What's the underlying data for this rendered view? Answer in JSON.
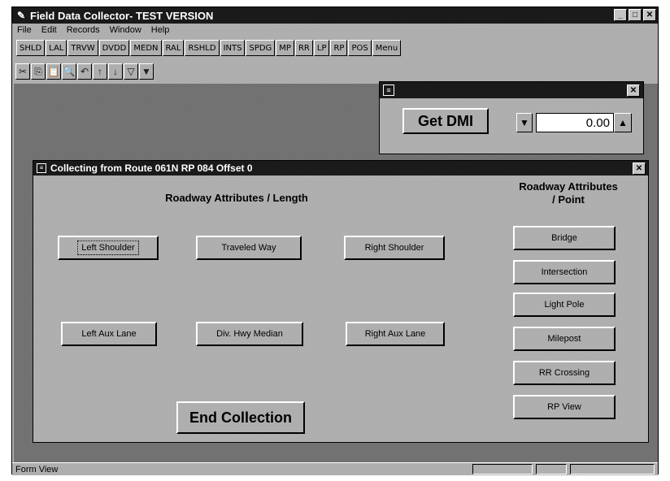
{
  "app": {
    "title": "Field Data Collector- TEST VERSION",
    "window_buttons": {
      "minimize": "_",
      "maximize": "□",
      "close": "✕"
    }
  },
  "menubar": {
    "items": [
      "File",
      "Edit",
      "Records",
      "Window",
      "Help"
    ]
  },
  "field_toolbar": {
    "buttons": [
      "SHLD",
      "LAL",
      "TRVW",
      "DVDD",
      "MEDN",
      "RAL",
      "RSHLD",
      "INTS",
      "SPDG",
      "MP",
      "RR",
      "LP",
      "RP",
      "POS",
      "Menu"
    ]
  },
  "toolbar": {
    "icons": [
      {
        "name": "cut-icon",
        "glyph": "✂"
      },
      {
        "name": "copy-icon",
        "glyph": "⎘"
      },
      {
        "name": "paste-icon",
        "glyph": "📋"
      },
      {
        "name": "find-icon",
        "glyph": "🔍"
      },
      {
        "name": "undo-icon",
        "glyph": "↶"
      },
      {
        "name": "sort-asc-icon",
        "glyph": "↑"
      },
      {
        "name": "sort-desc-icon",
        "glyph": "↓"
      },
      {
        "name": "filter-icon",
        "glyph": "▽"
      },
      {
        "name": "apply-filter-icon",
        "glyph": "▼"
      }
    ]
  },
  "dmi_panel": {
    "title": "",
    "get_dmi_label": "Get DMI",
    "value": "0.00",
    "decrement_glyph": "▼",
    "increment_glyph": "▲"
  },
  "collect_window": {
    "title": "Collecting from Route 061N RP 084  Offset  0",
    "length_header": "Roadway Attributes / Length",
    "point_header_line1": "Roadway Attributes",
    "point_header_line2": "/ Point",
    "length_buttons": {
      "left_shoulder": "Left Shoulder",
      "traveled_way": "Traveled Way",
      "right_shoulder": "Right Shoulder",
      "left_aux_lane": "Left Aux Lane",
      "div_hwy_median": "Div. Hwy Median",
      "right_aux_lane": "Right Aux Lane"
    },
    "point_buttons": [
      "Bridge",
      "Intersection",
      "Light Pole",
      "Milepost",
      "RR Crossing",
      "RP View"
    ],
    "end_collection_label": "End Collection"
  },
  "statusbar": {
    "text": "Form View"
  }
}
